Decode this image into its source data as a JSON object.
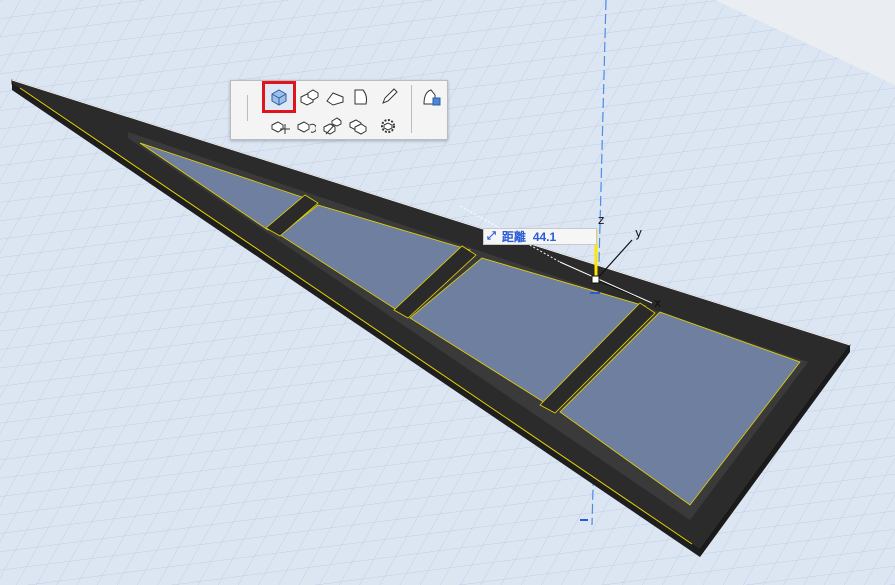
{
  "toolbar": {
    "row1": [
      {
        "name": "slab-solid-icon",
        "active": true
      },
      {
        "name": "extrude-icon",
        "active": false
      },
      {
        "name": "shape-profile-icon",
        "active": false
      },
      {
        "name": "shell-icon",
        "active": false
      },
      {
        "name": "pencil-icon",
        "active": false
      }
    ],
    "row2": [
      {
        "name": "move-icon"
      },
      {
        "name": "rotate-icon"
      },
      {
        "name": "split-icon"
      },
      {
        "name": "stack-icon"
      },
      {
        "name": "settings-gear-icon"
      }
    ],
    "extra": {
      "name": "roof-settings-icon"
    }
  },
  "distance_tooltip": {
    "label": "距離",
    "value": "44.1"
  },
  "axes": {
    "z": "z",
    "y": "y",
    "x": "x"
  },
  "colors": {
    "grid_bg": "#dce6f2",
    "frame": "#2a2a2a",
    "glass": "#6e7fa0",
    "highlight": "#ffe600",
    "accent_red": "#e0141c",
    "tip_text": "#2a5bd7"
  }
}
